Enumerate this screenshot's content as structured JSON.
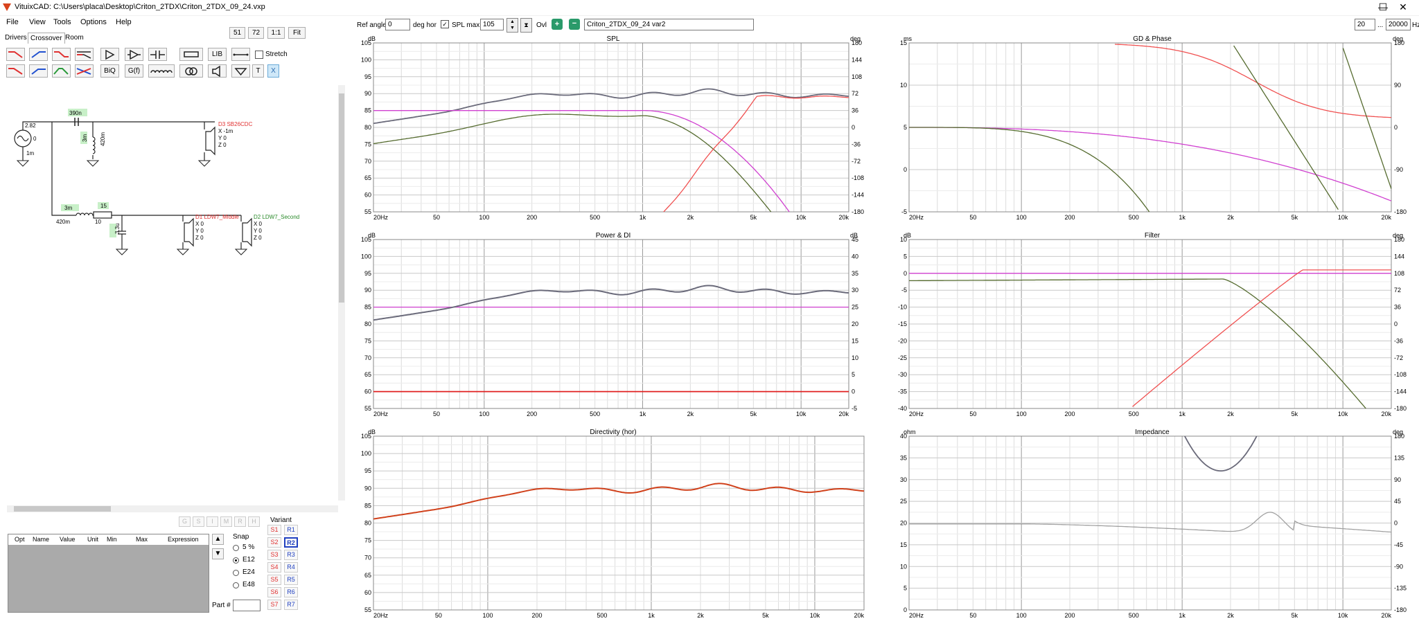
{
  "window": {
    "title": "VituixCAD: C:\\Users\\placa\\Desktop\\Criton_2TDX\\Criton_2TDX_09_24.vxp",
    "minimize": "—",
    "maximize": "☐",
    "close": "✕"
  },
  "menu": [
    "File",
    "View",
    "Tools",
    "Options",
    "Help"
  ],
  "tabs": [
    "Drivers",
    "Crossover",
    "Room"
  ],
  "view_buttons": [
    "51",
    "72",
    "1:1",
    "Fit"
  ],
  "toolbar": {
    "lib": "LIB",
    "biq": "BiQ",
    "gf": "G(f)",
    "t": "T",
    "x": "X",
    "stretch_label": "Stretch",
    "stretch_checked": false
  },
  "header": {
    "ref_angle_label": "Ref angle",
    "ref_angle_value": "0",
    "deg_hor": "deg hor",
    "spl_max_label": "SPL max",
    "spl_max_value": "105",
    "spl_max_checked": true,
    "ovl_label": "Ovl",
    "variant_name": "Criton_2TDX_09_24 var2",
    "freq_min": "20",
    "freq_sep": "...",
    "freq_max": "20000",
    "freq_unit": "Hz"
  },
  "schematic": {
    "source": {
      "v": "2.82",
      "phase": "0",
      "r": "1m"
    },
    "c1": "390n",
    "l1": "3m",
    "l1_dcr": "420m",
    "l2": "3m",
    "l2_dcr": "420m",
    "r1": "15",
    "r1_b": "10",
    "c2": "3.3u",
    "d3": {
      "name": "D3 SB26CDC",
      "x": "X -1m",
      "y": "Y 0",
      "z": "Z 0"
    },
    "d1": {
      "name": "D1 LDW7_Middle",
      "x": "X 0",
      "y": "Y 0",
      "z": "Z 0"
    },
    "d2": {
      "name": "D2 LDW7_Second",
      "x": "X 0",
      "y": "Y 0",
      "z": "Z 0"
    }
  },
  "table": {
    "columns": [
      "Opt",
      "Name",
      "Value",
      "Unit",
      "Min",
      "Max",
      "Expression"
    ]
  },
  "snap": {
    "label": "Snap",
    "options": [
      "5 %",
      "E12",
      "E24",
      "E48"
    ],
    "selected": "E12"
  },
  "part_label": "Part #",
  "variant": {
    "label": "Variant",
    "s": [
      "S1",
      "S2",
      "S3",
      "S4",
      "S5",
      "S6",
      "S7"
    ],
    "r": [
      "R1",
      "R2",
      "R3",
      "R4",
      "R5",
      "R6",
      "R7"
    ],
    "active": "R2"
  },
  "disabled_buttons": [
    "G",
    "S",
    "I",
    "M",
    "R",
    "H"
  ],
  "freq_ticks": [
    "20Hz",
    "50",
    "100",
    "200",
    "500",
    "1k",
    "2k",
    "5k",
    "10k",
    "20k"
  ],
  "graphs": {
    "spl": {
      "title": "SPL",
      "y_unit": "dB",
      "y2_unit": "deg",
      "y_ticks": [
        "105",
        "100",
        "95",
        "90",
        "85",
        "80",
        "75",
        "70",
        "65",
        "60",
        "55"
      ],
      "y2_ticks": [
        "180",
        "144",
        "108",
        "72",
        "36",
        "0",
        "-36",
        "-72",
        "-108",
        "-144",
        "-180"
      ]
    },
    "gd": {
      "title": "GD & Phase",
      "y_unit": "ms",
      "y2_unit": "deg",
      "y_ticks": [
        "15",
        "10",
        "5",
        "0",
        "-5"
      ],
      "y2_ticks": [
        "180",
        "90",
        "0",
        "-90",
        "-180"
      ]
    },
    "power": {
      "title": "Power & DI",
      "y_unit": "dB",
      "y2_unit": "dB",
      "y_ticks": [
        "105",
        "100",
        "95",
        "90",
        "85",
        "80",
        "75",
        "70",
        "65",
        "60",
        "55"
      ],
      "y2_ticks": [
        "45",
        "40",
        "35",
        "30",
        "25",
        "20",
        "15",
        "10",
        "5",
        "0",
        "-5"
      ]
    },
    "filter": {
      "title": "Filter",
      "y_unit": "dB",
      "y2_unit": "deg",
      "y_ticks": [
        "10",
        "5",
        "0",
        "-5",
        "-10",
        "-15",
        "-20",
        "-25",
        "-30",
        "-35",
        "-40"
      ],
      "y2_ticks": [
        "180",
        "144",
        "108",
        "72",
        "36",
        "0",
        "-36",
        "-72",
        "-108",
        "-144",
        "-180"
      ]
    },
    "directivity": {
      "title": "Directivity (hor)",
      "y_unit": "dB",
      "y_ticks": [
        "105",
        "100",
        "95",
        "90",
        "85",
        "80",
        "75",
        "70",
        "65",
        "60",
        "55"
      ]
    },
    "impedance": {
      "title": "Impedance",
      "y_unit": "ohm",
      "y2_unit": "deg",
      "y_ticks": [
        "40",
        "35",
        "30",
        "25",
        "20",
        "15",
        "10",
        "5",
        "0"
      ],
      "y2_ticks": [
        "180",
        "135",
        "90",
        "45",
        "0",
        "-45",
        "-90",
        "-135",
        "-180"
      ]
    }
  },
  "colors": {
    "woofer": "#556b2f",
    "tweeter": "#f05050",
    "sum": "#6a6a7a",
    "target": "#d040d0",
    "di": "#e02020",
    "dir": "#d0401a",
    "imp_phase": "#a0a0a0"
  }
}
